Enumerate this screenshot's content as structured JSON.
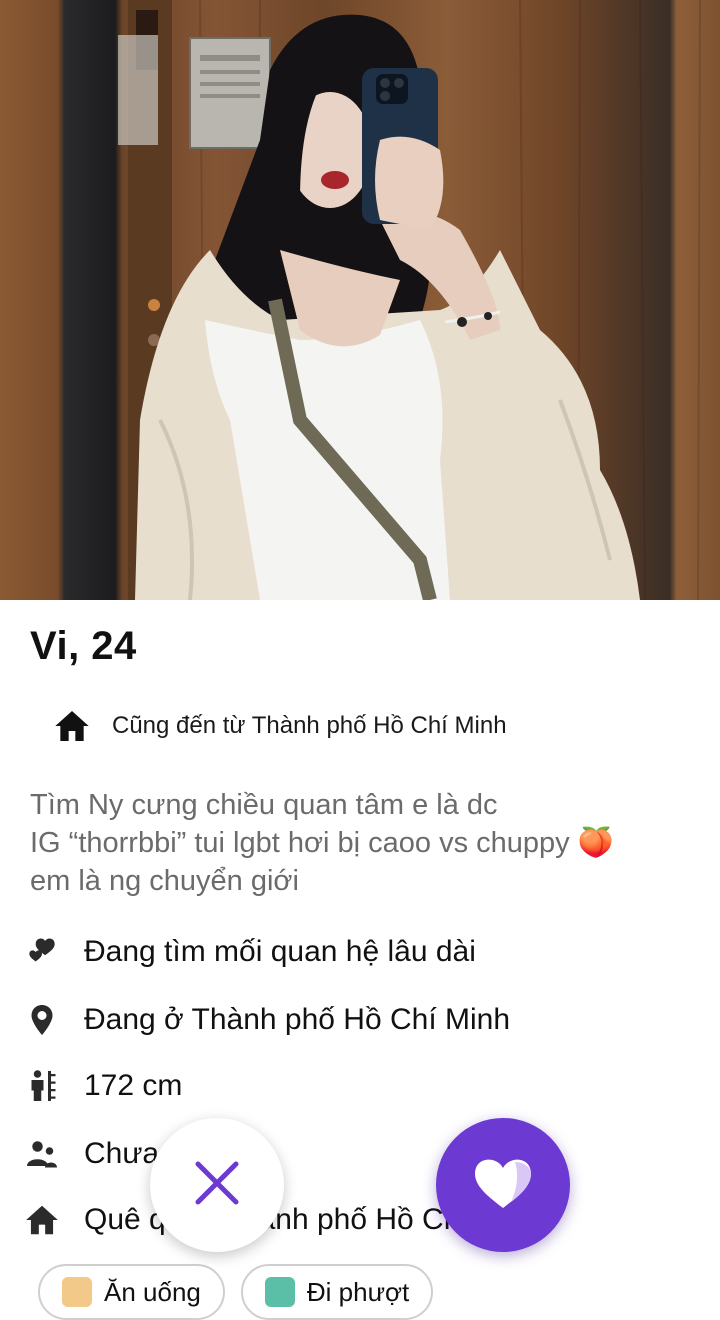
{
  "profile": {
    "name_age": "Vi, 24",
    "origin": "Cũng đến từ Thành phố Hồ Chí Minh",
    "bio_lines": [
      "Tìm Ny cưng chiều quan tâm e là dc",
      "IG “thorrbbi” tui lgbt hơi bị caoo vs chuppy 🍑",
      "em là ng chuyển giới"
    ],
    "details": [
      {
        "icon": "hearts-icon",
        "text": "Đang tìm mối quan hệ lâu dài"
      },
      {
        "icon": "location-pin-icon",
        "text": "Đang ở Thành phố Hồ Chí Minh"
      },
      {
        "icon": "height-icon",
        "text": "172 cm"
      },
      {
        "icon": "people-icon",
        "text": "Chưa"
      },
      {
        "icon": "home-icon",
        "text": "Quê quán Thành phố Hồ Chí Minh"
      }
    ],
    "interests": [
      {
        "icon": "noodles-emoji",
        "label": "Ăn uống"
      },
      {
        "icon": "map-emoji",
        "label": "Đi phượt"
      }
    ]
  },
  "actions": {
    "pass_icon": "close-icon",
    "like_icon": "heart-icon"
  },
  "colors": {
    "accent": "#6c3ad2",
    "bio_text": "#6b6b6b",
    "icon": "#2b2b2b"
  }
}
